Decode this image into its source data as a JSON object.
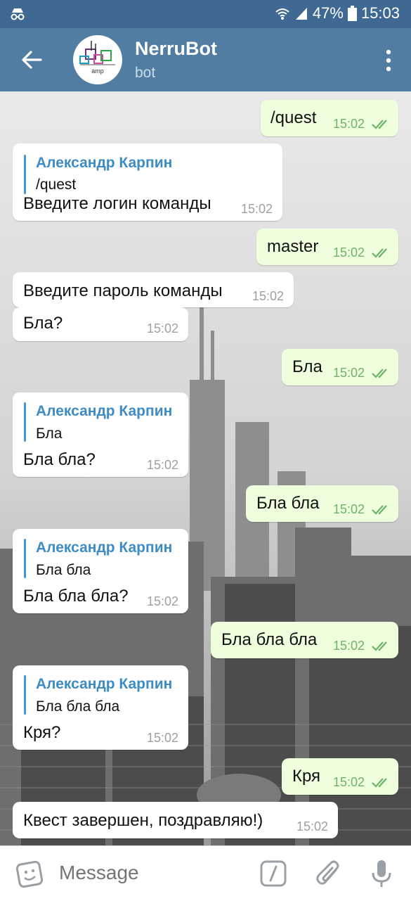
{
  "status_bar": {
    "battery": "47%",
    "time": "15:03",
    "icons": [
      "incognito-icon",
      "wifi-icon",
      "signal-icon",
      "battery-icon"
    ]
  },
  "header": {
    "title": "NerruBot",
    "subtitle": "bot",
    "avatar_text": "amp"
  },
  "messages": [
    {
      "dir": "out",
      "text": "/quest",
      "time": "15:02",
      "is_command": true
    },
    {
      "dir": "in",
      "quote_name": "Александр Карпин",
      "quote_text": "/quest",
      "text": "Введите логин команды",
      "time": "15:02"
    },
    {
      "dir": "out",
      "text": "master",
      "time": "15:02"
    },
    {
      "dir": "in",
      "text": "Введите пароль команды",
      "time": "15:02"
    },
    {
      "dir": "in",
      "text": "Бла?",
      "time": "15:02"
    },
    {
      "dir": "out",
      "text": "Бла",
      "time": "15:02"
    },
    {
      "dir": "in",
      "quote_name": "Александр Карпин",
      "quote_text": "Бла",
      "text": "Бла бла?",
      "time": "15:02"
    },
    {
      "dir": "out",
      "text": "Бла бла",
      "time": "15:02"
    },
    {
      "dir": "in",
      "quote_name": "Александр Карпин",
      "quote_text": "Бла бла",
      "text": "Бла бла бла?",
      "time": "15:02"
    },
    {
      "dir": "out",
      "text": "Бла бла бла",
      "time": "15:02"
    },
    {
      "dir": "in",
      "quote_name": "Александр Карпин",
      "quote_text": "Бла бла бла",
      "text": "Кря?",
      "time": "15:02"
    },
    {
      "dir": "out",
      "text": "Кря",
      "time": "15:02"
    },
    {
      "dir": "in",
      "text": "Квест завершен, поздравляю!)",
      "time": "15:02"
    }
  ],
  "input": {
    "placeholder": "Message"
  },
  "colors": {
    "header": "#517da2",
    "status_bar": "#3f6893",
    "outgoing_bubble": "#effedd",
    "incoming_bubble": "#ffffff",
    "quote_accent": "#3d9ad6",
    "read_checks": "#6fb36a"
  }
}
